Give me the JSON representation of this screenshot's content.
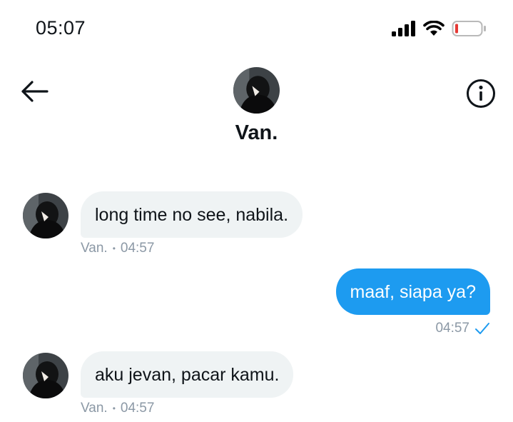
{
  "status_bar": {
    "time": "05:07",
    "icons": [
      "cellular-signal-icon",
      "wifi-icon",
      "battery-low-icon"
    ],
    "battery_color": "#e53935"
  },
  "header": {
    "back_icon": "back-arrow-icon",
    "info_icon": "info-icon",
    "contact_name": "Van."
  },
  "messages": [
    {
      "direction": "incoming",
      "text": "long time no see, nabila.",
      "sender": "Van.",
      "separator": "•",
      "time": "04:57"
    },
    {
      "direction": "outgoing",
      "text": "maaf, siapa ya?",
      "time": "04:57",
      "status_icon": "sent-check-icon"
    },
    {
      "direction": "incoming",
      "text": "aku jevan, pacar kamu.",
      "sender": "Van.",
      "separator": "•",
      "time": "04:57"
    }
  ],
  "colors": {
    "outgoing_bubble": "#1d9bf0",
    "incoming_bubble": "#eff3f4",
    "meta_text": "#8b98a5",
    "check": "#1d9bf0"
  }
}
